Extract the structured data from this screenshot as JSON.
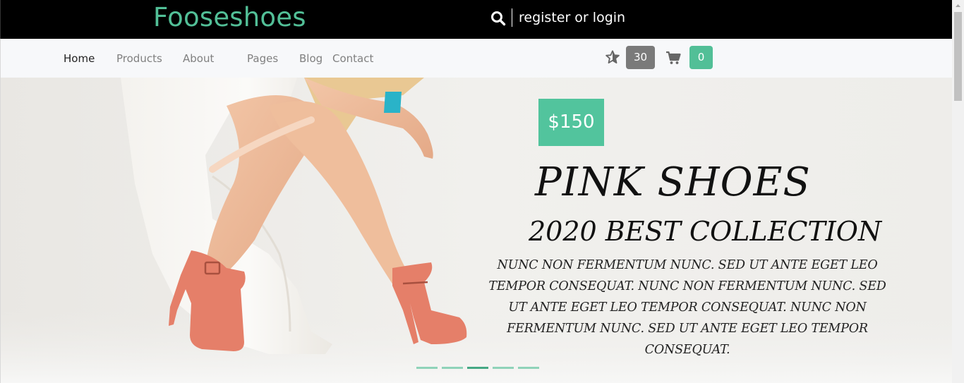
{
  "header": {
    "logo": "Fooseshoes",
    "login_link": "register or login",
    "icons": {
      "search": "search-icon"
    }
  },
  "nav": {
    "items": [
      {
        "label": "Home",
        "active": true
      },
      {
        "label": "Products",
        "active": false
      },
      {
        "label": "About",
        "active": false
      },
      {
        "label": "Pages",
        "active": false
      },
      {
        "label": "Blog",
        "active": false
      },
      {
        "label": "Contact",
        "active": false
      }
    ],
    "wishlist_icon": "star-icon",
    "wishlist_count": "30",
    "cart_icon": "cart-icon",
    "cart_count": "0"
  },
  "hero": {
    "price": "$150",
    "title": "PINK SHOES",
    "subtitle": "2020 BEST COLLECTION",
    "description": "NUNC NON FERMENTUM NUNC. SED UT ANTE EGET LEO TEMPOR CONSEQUAT. NUNC NON FERMENTUM NUNC. SED UT ANTE EGET LEO TEMPOR CONSEQUAT. NUNC NON FERMENTUM NUNC. SED UT ANTE EGET LEO TEMPOR CONSEQUAT.",
    "slides_total": 5,
    "active_slide": 3
  },
  "colors": {
    "brand": "#52bf97",
    "topbar": "#000000",
    "navbar": "#f7f8fa",
    "wishlist_badge": "#7a7a7a",
    "cart_badge": "#52bf97",
    "price_badge": "#52c49d"
  }
}
